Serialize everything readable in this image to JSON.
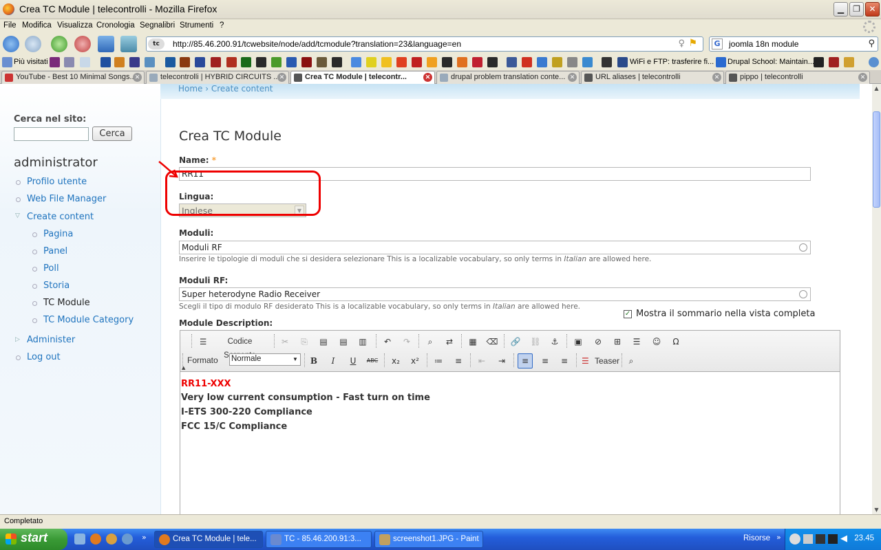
{
  "window": {
    "title": "Crea TC Module | telecontrolli - Mozilla Firefox"
  },
  "menu": [
    "File",
    "Modifica",
    "Visualizza",
    "Cronologia",
    "Segnalibri",
    "Strumenti",
    "?"
  ],
  "navbar": {
    "url": "http://85.46.200.91/tcwebsite/node/add/tcmodule?translation=23&language=en",
    "search_engine": "G",
    "search_query": "joomla 18n module"
  },
  "bookmarks": {
    "first": "Più visitati",
    "wifi": "WiFi e FTP: trasferire fi...",
    "drupal_school": "Drupal School: Maintain..."
  },
  "tabs": [
    {
      "label": "YouTube - Best 10 Minimal Songs..."
    },
    {
      "label": "telecontrolli | HYBRID CIRCUITS ..."
    },
    {
      "label": "Crea TC Module | telecontr..."
    },
    {
      "label": "drupal problem translation conte..."
    },
    {
      "label": "URL aliases | telecontrolli"
    },
    {
      "label": "pippo | telecontrolli"
    }
  ],
  "breadcrumb": "Home › Create content",
  "sidebar": {
    "search_label": "Cerca nel sito:",
    "search_button": "Cerca",
    "user": "administrator",
    "items": [
      {
        "label": "Profilo utente"
      },
      {
        "label": "Web File Manager"
      },
      {
        "label": "Create content"
      },
      {
        "label": "Pagina"
      },
      {
        "label": "Panel"
      },
      {
        "label": "Poll"
      },
      {
        "label": "Storia"
      },
      {
        "label": "TC Module"
      },
      {
        "label": "TC Module Category"
      },
      {
        "label": "Administer"
      },
      {
        "label": "Log out"
      }
    ]
  },
  "form": {
    "title": "Crea TC Module",
    "name_label": "Name:",
    "required_mark": "*",
    "name_value": "RR11",
    "lingua_label": "Lingua:",
    "lingua_value": "Inglese",
    "moduli_label": "Moduli:",
    "moduli_value": "Moduli RF",
    "moduli_help_prefix": "Inserire le tipologie di moduli che si desidera selezionare This is a localizable vocabulary, so only terms in ",
    "italian": "Italian",
    "help_suffix": " are allowed here.",
    "moduli_rf_label": "Moduli RF:",
    "moduli_rf_value": "Super heterodyne Radio Receiver",
    "moduli_rf_help_prefix": "Scegli il tipo di modulo RF desiderato This is a localizable vocabulary, so only terms in ",
    "summary_label": "Mostra il sommario nella vista completa",
    "desc_label": "Module Description:"
  },
  "editor": {
    "source_button": "Codice Sorgente",
    "format_label": "Formato",
    "format_value": "Normale",
    "teaser_button": "Teaser",
    "lines": [
      "RR11-XXX",
      "Very low current consumption - Fast turn on time",
      "I-ETS 300-220 Compliance",
      "FCC 15/C Compliance"
    ]
  },
  "status": "Completato",
  "taskbar": {
    "start": "start",
    "tasks": [
      {
        "label": "Crea TC Module | tele..."
      },
      {
        "label": "TC - 85.46.200.91:3..."
      },
      {
        "label": "screenshot1.JPG - Paint"
      }
    ],
    "risorse": "Risorse",
    "clock": "23.45"
  },
  "colors": {
    "accent_link": "#1e73be",
    "annotation": "#e00000",
    "taskbar": "#245edb"
  }
}
